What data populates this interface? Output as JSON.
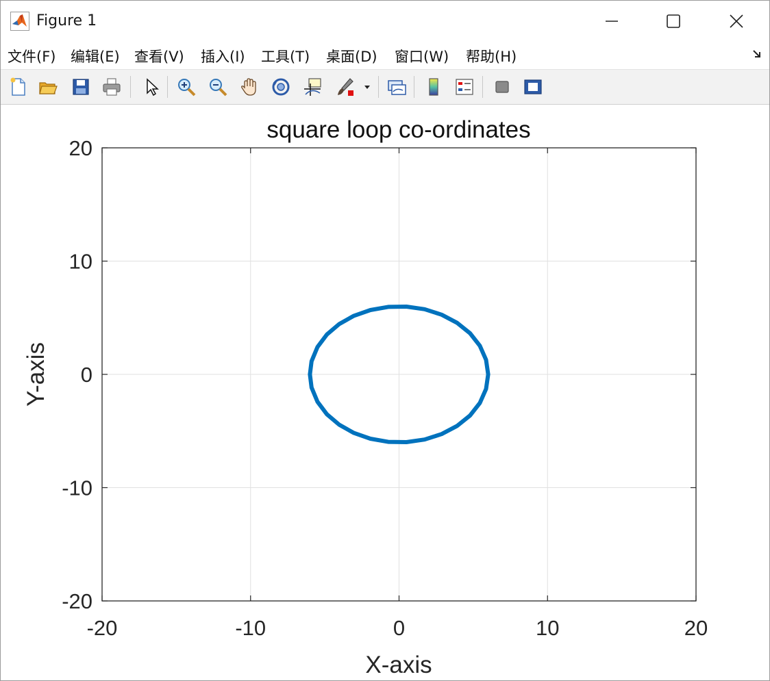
{
  "window": {
    "title": "Figure 1",
    "minimize_icon": "minimize-icon",
    "maximize_icon": "maximize-icon",
    "close_icon": "close-icon"
  },
  "menu": {
    "items": [
      "文件(F)",
      "编辑(E)",
      "查看(V)",
      "插入(I)",
      "工具(T)",
      "桌面(D)",
      "窗口(W)",
      "帮助(H)"
    ]
  },
  "toolbar": {
    "icons": [
      "new-figure-icon",
      "open-file-icon",
      "save-icon",
      "print-icon",
      "pointer-icon",
      "zoom-in-icon",
      "zoom-out-icon",
      "pan-icon",
      "rotate-3d-icon",
      "data-cursor-icon",
      "brush-icon",
      "link-plot-icon",
      "colorbar-icon",
      "legend-icon",
      "hide-plot-tools-icon",
      "show-plot-tools-icon"
    ]
  },
  "colors": {
    "line": "#0072bd",
    "grid": "#e0e0e0",
    "axis": "#262626"
  },
  "chart_data": {
    "type": "line",
    "title": "square loop co-ordinates",
    "xlabel": "X-axis",
    "ylabel": "Y-axis",
    "xlim": [
      -20,
      20
    ],
    "ylim": [
      -20,
      20
    ],
    "xticks": [
      -20,
      -10,
      0,
      10,
      20
    ],
    "yticks": [
      -20,
      -10,
      0,
      10,
      20
    ],
    "xtick_labels": [
      "-20",
      "-10",
      "0",
      "10",
      "20"
    ],
    "ytick_labels": [
      "-20",
      "-10",
      "0",
      "10",
      "20"
    ],
    "grid": true,
    "series": [
      {
        "x": [
          6.0,
          5.86,
          5.44,
          4.78,
          3.91,
          2.87,
          1.72,
          0.5,
          -0.73,
          -1.93,
          -3.04,
          -4.03,
          -4.86,
          -5.49,
          -5.89,
          -6.0,
          -5.89,
          -5.49,
          -4.86,
          -4.03,
          -3.04,
          -1.93,
          -0.73,
          0.5,
          1.72,
          2.87,
          3.91,
          4.78,
          5.44,
          5.86,
          6.0
        ],
        "y": [
          0.0,
          1.29,
          2.53,
          3.63,
          4.55,
          5.27,
          5.75,
          5.98,
          5.96,
          5.68,
          5.17,
          4.44,
          3.52,
          2.42,
          1.16,
          0.0,
          -1.16,
          -2.42,
          -3.52,
          -4.44,
          -5.17,
          -5.68,
          -5.96,
          -5.98,
          -5.75,
          -5.27,
          -4.55,
          -3.63,
          -2.53,
          -1.29,
          0.0
        ]
      }
    ]
  }
}
